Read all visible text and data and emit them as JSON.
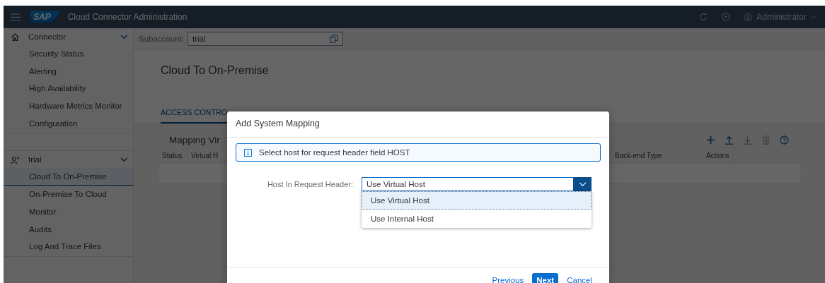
{
  "header": {
    "logo": "SAP",
    "title": "Cloud Connector Administration",
    "user": "Administrator"
  },
  "sidebar": {
    "groups": [
      {
        "kind": "home",
        "label": "Connector",
        "expanded": true,
        "items": [
          {
            "label": "Security Status",
            "selected": false
          },
          {
            "label": "Alerting",
            "selected": false
          },
          {
            "label": "High Availability",
            "selected": false
          },
          {
            "label": "Hardware Metrics Monitor",
            "selected": false
          },
          {
            "label": "Configuration",
            "selected": false
          }
        ]
      },
      {
        "kind": "account",
        "label": "trial",
        "expanded": true,
        "items": [
          {
            "label": "Cloud To On-Premise",
            "selected": true
          },
          {
            "label": "On-Premise To Cloud",
            "selected": false
          },
          {
            "label": "Monitor",
            "selected": false
          },
          {
            "label": "Audits",
            "selected": false
          },
          {
            "label": "Log And Trace Files",
            "selected": false
          }
        ]
      }
    ]
  },
  "subaccount": {
    "label": "Subaccount:",
    "value": "trial"
  },
  "page": {
    "title": "Cloud To On-Premise",
    "tabs": [
      {
        "label": "ACCESS CONTRO",
        "selected": true
      }
    ],
    "section_title": "Mapping Vir",
    "toolbar": [
      {
        "kind": "add",
        "disabled": false
      },
      {
        "kind": "upload",
        "disabled": false
      },
      {
        "kind": "download",
        "disabled": true
      },
      {
        "kind": "delete",
        "disabled": true
      },
      {
        "kind": "help",
        "disabled": false
      }
    ],
    "table": {
      "columns": [
        "Status",
        "Virtual H",
        "Back-end Type",
        "Actions"
      ]
    }
  },
  "dialog": {
    "title": "Add System Mapping",
    "info": "Select host for request header field HOST",
    "field_label": "Host In Request Header:",
    "value": "Use Virtual Host",
    "options": [
      {
        "label": "Use Virtual Host",
        "selected": true
      },
      {
        "label": "Use Internal Host",
        "selected": false
      }
    ],
    "buttons": [
      {
        "label": "Previous",
        "kind": "link"
      },
      {
        "label": "Next",
        "kind": "primary"
      },
      {
        "label": "Cancel",
        "kind": "link"
      }
    ]
  }
}
